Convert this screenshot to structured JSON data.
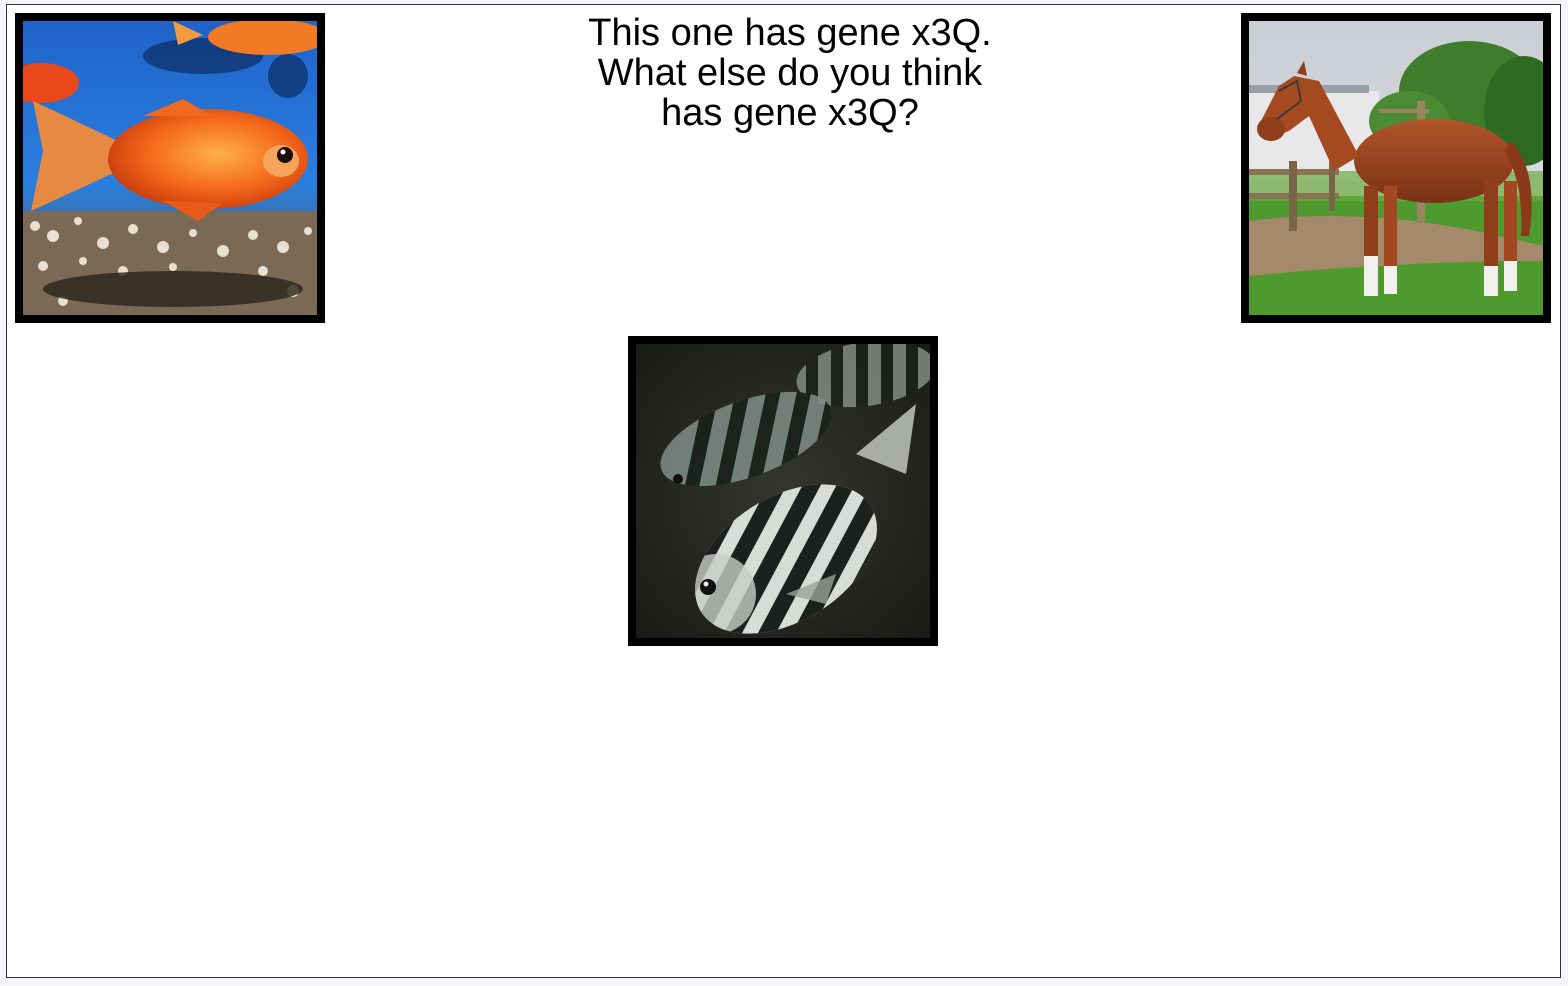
{
  "question": {
    "lines": [
      "This one has gene x3Q.",
      "What else do you think",
      "has gene x3Q?"
    ]
  },
  "images": {
    "goldfish": {
      "icon": "goldfish-image",
      "role": "choice"
    },
    "horse": {
      "icon": "horse-image",
      "role": "choice"
    },
    "sheepshead": {
      "icon": "striped-fish-image",
      "role": "example"
    }
  },
  "colors": {
    "frame_border": "#000000",
    "background": "#ffffff"
  }
}
